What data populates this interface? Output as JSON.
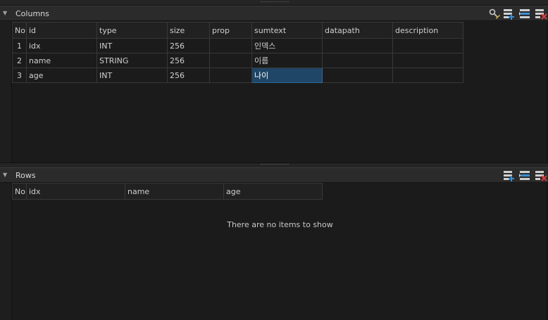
{
  "columns_panel": {
    "title": "Columns",
    "headers": [
      "No",
      "id",
      "type",
      "size",
      "prop",
      "sumtext",
      "datapath",
      "description"
    ],
    "rows": [
      {
        "no": "1",
        "id": "idx",
        "type": "INT",
        "size": "256",
        "prop": "",
        "sumtext": "인덱스",
        "datapath": "",
        "description": ""
      },
      {
        "no": "2",
        "id": "name",
        "type": "STRING",
        "size": "256",
        "prop": "",
        "sumtext": "이름",
        "datapath": "",
        "description": ""
      },
      {
        "no": "3",
        "id": "age",
        "type": "INT",
        "size": "256",
        "prop": "",
        "sumtext": "나이",
        "datapath": "",
        "description": ""
      }
    ],
    "toolbar_icons": [
      "key-edit-icon",
      "add-row-icon",
      "insert-row-icon",
      "delete-row-icon"
    ]
  },
  "rows_panel": {
    "title": "Rows",
    "headers": [
      "No",
      "idx",
      "name",
      "age"
    ],
    "empty_message": "There are no items to show",
    "toolbar_icons": [
      "add-row-icon",
      "insert-row-icon",
      "delete-row-icon"
    ]
  },
  "colors": {
    "selection": "#1f4567",
    "add_accent": "#3a8fd8",
    "delete_accent": "#e03c3c",
    "key_accent": "#e0b040"
  }
}
